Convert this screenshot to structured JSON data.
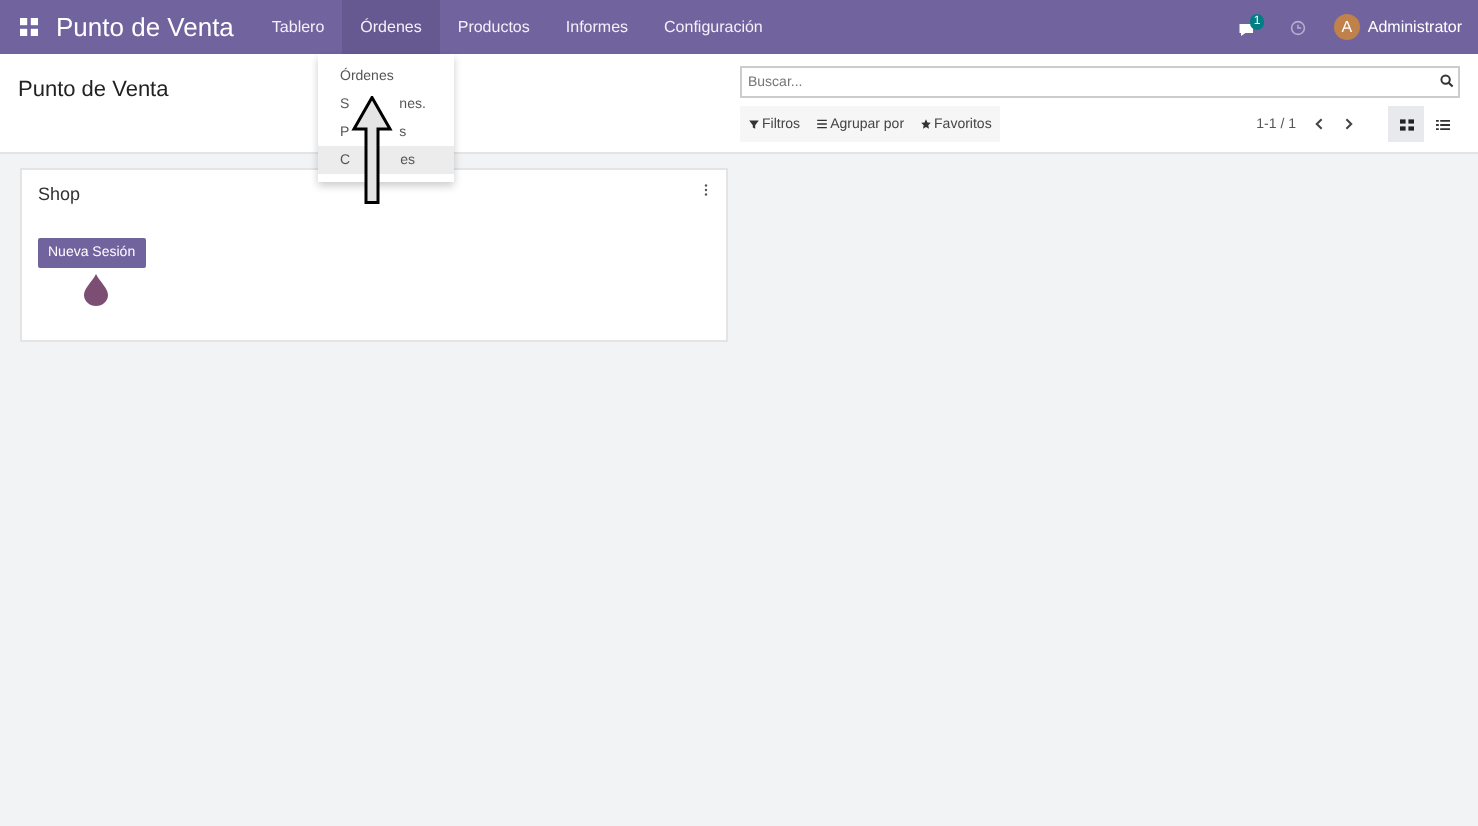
{
  "navbar": {
    "app_title": "Punto de Venta",
    "menu": [
      {
        "label": "Tablero",
        "selected": false
      },
      {
        "label": "Órdenes",
        "selected": true
      },
      {
        "label": "Productos",
        "selected": false
      },
      {
        "label": "Informes",
        "selected": false
      },
      {
        "label": "Configuración",
        "selected": false
      }
    ],
    "messages_badge": "1",
    "user": {
      "initial": "A",
      "name": "Administrator"
    }
  },
  "dropdown": {
    "items": [
      {
        "parts": [
          "Órdenes"
        ],
        "selected": false
      },
      {
        "parts": [
          "S",
          "nes."
        ],
        "selected": false
      },
      {
        "parts": [
          "P",
          "s"
        ],
        "selected": false
      },
      {
        "parts": [
          "C",
          "es"
        ],
        "selected": true
      }
    ]
  },
  "control_panel": {
    "breadcrumb": "Punto de Venta",
    "search": {
      "placeholder": "Buscar..."
    },
    "filters": [
      "Filtros",
      "Agrupar por",
      "Favoritos"
    ],
    "pager": "1-1 / 1",
    "views": [
      {
        "kind": "kanban",
        "selected": true
      },
      {
        "kind": "list",
        "selected": false
      }
    ]
  },
  "cards": [
    {
      "title": "Shop",
      "button": "Nueva Sesión"
    }
  ]
}
